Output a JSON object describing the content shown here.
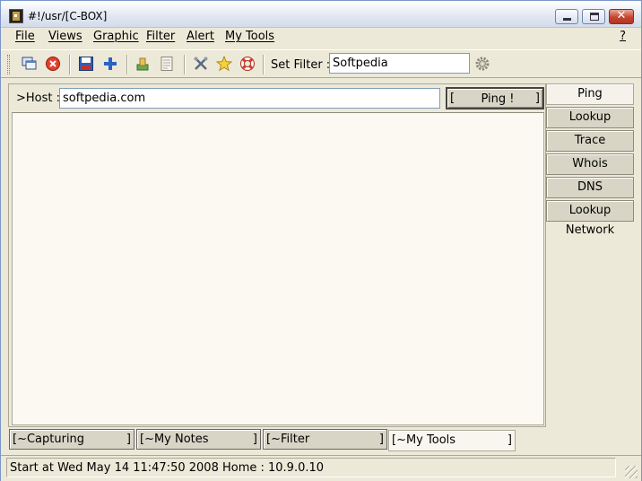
{
  "window": {
    "title": "#!/usr/[C-BOX]"
  },
  "menu": {
    "items": [
      "File",
      "Views",
      "Graphic",
      "Filter",
      "Alert",
      "My Tools"
    ],
    "help": "?"
  },
  "toolbar": {
    "icons": [
      "windows-icon",
      "stop-icon",
      "save-icon",
      "add-icon",
      "clear-icon",
      "notes-icon",
      "tools-icon",
      "star-icon",
      "lifebuoy-icon",
      "gear-icon"
    ],
    "filter_label": "Set Filter :",
    "filter_value": "Softpedia"
  },
  "host": {
    "label": ">Host :",
    "value": "softpedia.com",
    "ping_open": "[",
    "ping_label": "Ping !",
    "ping_close": "]"
  },
  "tools": {
    "tabs": [
      "Ping",
      "Lookup",
      "Trace",
      "Whois",
      "DNS",
      "Lookup Network"
    ],
    "active": "Ping"
  },
  "bottom_tabs": {
    "tabs": [
      "[~Capturing",
      "[~My Notes",
      "[~Filter",
      "[~My Tools"
    ],
    "close": "]",
    "active": "[~My Tools"
  },
  "status": {
    "text": "Start at Wed May 14 11:47:50 2008 Home : 10.9.0.10"
  },
  "colors": {
    "window_bg": "#ece9d8",
    "output_bg": "#fbf9f2",
    "close_button": "#c5442f"
  }
}
